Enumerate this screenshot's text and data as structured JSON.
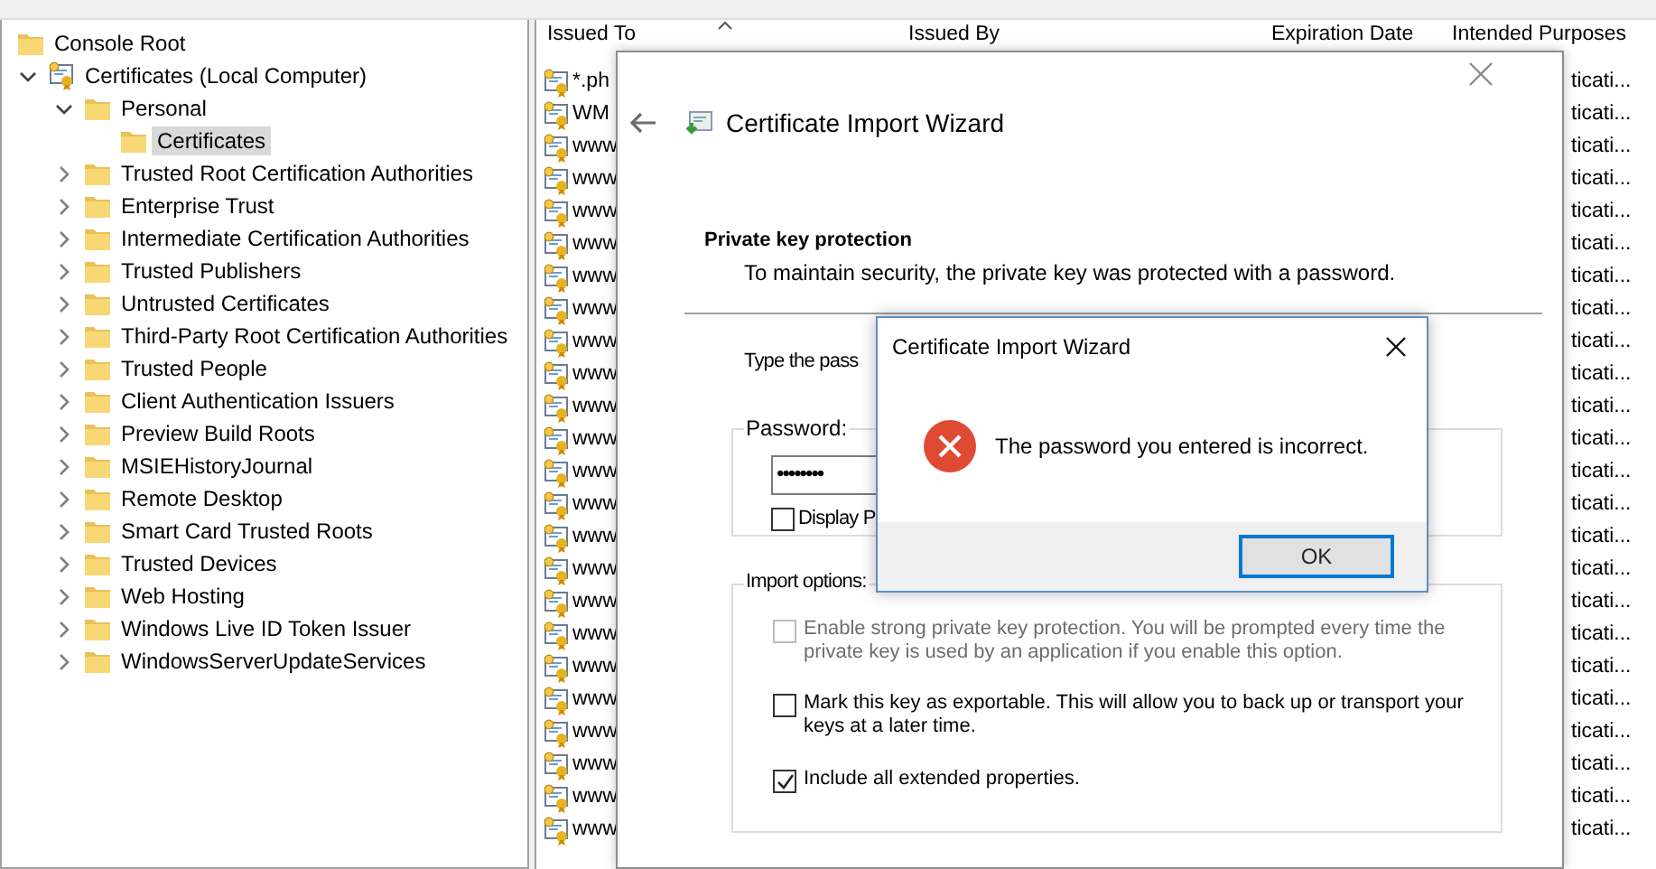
{
  "tree": [
    {
      "label": "Console Root",
      "kind": "folder",
      "selected": false,
      "children": [
        {
          "label": "Certificates (Local Computer)",
          "kind": "store",
          "expanded": true,
          "selected": false,
          "children": [
            {
              "label": "Personal",
              "kind": "folder",
              "expanded": true,
              "selected": false,
              "children": [
                {
                  "label": "Certificates",
                  "kind": "folder",
                  "selected": true
                }
              ]
            },
            {
              "label": "Trusted Root Certification Authorities",
              "kind": "folder",
              "expanded": false,
              "selected": false
            },
            {
              "label": "Enterprise Trust",
              "kind": "folder",
              "expanded": false,
              "selected": false
            },
            {
              "label": "Intermediate Certification Authorities",
              "kind": "folder",
              "expanded": false,
              "selected": false
            },
            {
              "label": "Trusted Publishers",
              "kind": "folder",
              "expanded": false,
              "selected": false
            },
            {
              "label": "Untrusted Certificates",
              "kind": "folder",
              "expanded": false,
              "selected": false
            },
            {
              "label": "Third-Party Root Certification Authorities",
              "kind": "folder",
              "expanded": false,
              "selected": false
            },
            {
              "label": "Trusted People",
              "kind": "folder",
              "expanded": false,
              "selected": false
            },
            {
              "label": "Client Authentication Issuers",
              "kind": "folder",
              "expanded": false,
              "selected": false
            },
            {
              "label": "Preview Build Roots",
              "kind": "folder",
              "expanded": false,
              "selected": false
            },
            {
              "label": "MSIEHistoryJournal",
              "kind": "folder",
              "expanded": false,
              "selected": false
            },
            {
              "label": "Remote Desktop",
              "kind": "folder",
              "expanded": false,
              "selected": false
            },
            {
              "label": "Smart Card Trusted Roots",
              "kind": "folder",
              "expanded": false,
              "selected": false
            },
            {
              "label": "Trusted Devices",
              "kind": "folder",
              "expanded": false,
              "selected": false
            },
            {
              "label": "Web Hosting",
              "kind": "folder",
              "expanded": false,
              "selected": false
            },
            {
              "label": "Windows Live ID Token Issuer",
              "kind": "folder",
              "expanded": false,
              "selected": false
            },
            {
              "label": "WindowsServerUpdateServices",
              "kind": "folder",
              "expanded": false,
              "selected": false
            }
          ]
        }
      ]
    }
  ],
  "list": {
    "columns": [
      {
        "label": "Issued To",
        "sorted": true
      },
      {
        "label": "Issued By",
        "sorted": false
      },
      {
        "label": "Expiration Date",
        "sorted": false
      },
      {
        "label": "Intended Purposes",
        "sorted": false
      }
    ],
    "rows": [
      {
        "issued_to": "*.ph",
        "purposes": "ticati..."
      },
      {
        "issued_to": "WM",
        "purposes": "ticati..."
      },
      {
        "issued_to": "www",
        "purposes": "ticati..."
      },
      {
        "issued_to": "www",
        "purposes": "ticati..."
      },
      {
        "issued_to": "www",
        "purposes": "ticati..."
      },
      {
        "issued_to": "www",
        "purposes": "ticati..."
      },
      {
        "issued_to": "www",
        "purposes": "ticati..."
      },
      {
        "issued_to": "www",
        "purposes": "ticati..."
      },
      {
        "issued_to": "www",
        "purposes": "ticati..."
      },
      {
        "issued_to": "www",
        "purposes": "ticati..."
      },
      {
        "issued_to": "www",
        "purposes": "ticati..."
      },
      {
        "issued_to": "www",
        "purposes": "ticati..."
      },
      {
        "issued_to": "www",
        "purposes": "ticati..."
      },
      {
        "issued_to": "www",
        "purposes": "ticati..."
      },
      {
        "issued_to": "www",
        "purposes": "ticati..."
      },
      {
        "issued_to": "www",
        "purposes": "ticati..."
      },
      {
        "issued_to": "www",
        "purposes": "ticati..."
      },
      {
        "issued_to": "www",
        "purposes": "ticati..."
      },
      {
        "issued_to": "www",
        "purposes": "ticati..."
      },
      {
        "issued_to": "www",
        "purposes": "ticati..."
      },
      {
        "issued_to": "www",
        "purposes": "ticati..."
      },
      {
        "issued_to": "www",
        "purposes": "ticati..."
      },
      {
        "issued_to": "www",
        "purposes": "ticati..."
      },
      {
        "issued_to": "www",
        "purposes": "ticati..."
      }
    ]
  },
  "wizard": {
    "title": "Certificate Import Wizard",
    "heading": "Private key protection",
    "description": "To maintain security, the private key was protected with a password.",
    "prompt": "Type the pass",
    "password_group": {
      "legend": "Password:",
      "value": "••••••••",
      "show_checkbox": {
        "label": "Display P",
        "checked": false
      }
    },
    "import_group": {
      "legend": "Import options:",
      "options": [
        {
          "label": "Enable strong private key protection. You will be prompted every time the private key is used by an application if you enable this option.",
          "checked": false,
          "disabled": true
        },
        {
          "label": "Mark this key as exportable. This will allow you to back up or transport your keys at a later time.",
          "checked": false,
          "disabled": false
        },
        {
          "label": "Include all extended properties.",
          "checked": true,
          "disabled": false
        }
      ]
    }
  },
  "error_dialog": {
    "title": "Certificate Import Wizard",
    "message": "The password you entered is incorrect.",
    "button": "OK"
  }
}
